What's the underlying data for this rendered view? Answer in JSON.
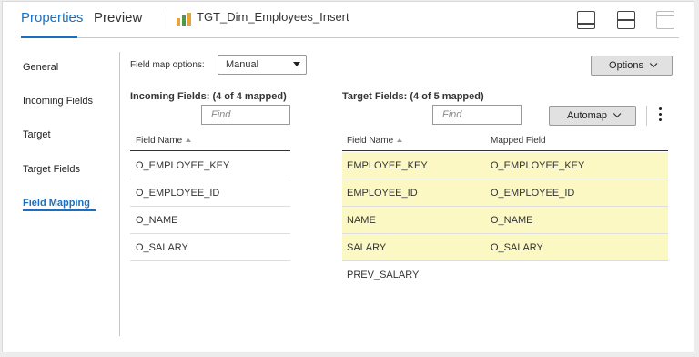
{
  "tabs": [
    {
      "label": "Properties",
      "active": true
    },
    {
      "label": "Preview",
      "active": false
    }
  ],
  "object_title": "TGT_Dim_Employees_Insert",
  "nav_items": [
    "General",
    "Incoming Fields",
    "Target",
    "Target Fields",
    "Field Mapping"
  ],
  "nav_active": "Field Mapping",
  "field_map_options_label": "Field map options:",
  "field_map_options_value": "Manual",
  "options_button": "Options",
  "incoming": {
    "title": "Incoming Fields: (4 of 4 mapped)",
    "find_placeholder": "Find",
    "header": "Field Name",
    "rows": [
      "O_EMPLOYEE_KEY",
      "O_EMPLOYEE_ID",
      "O_NAME",
      "O_SALARY"
    ]
  },
  "target": {
    "title": "Target Fields: (4 of 5 mapped)",
    "find_placeholder": "Find",
    "automap_button": "Automap",
    "header_field": "Field Name",
    "header_mapped": "Mapped Field",
    "rows": [
      {
        "field": "EMPLOYEE_KEY",
        "mapped": "O_EMPLOYEE_KEY"
      },
      {
        "field": "EMPLOYEE_ID",
        "mapped": "O_EMPLOYEE_ID"
      },
      {
        "field": "NAME",
        "mapped": "O_NAME"
      },
      {
        "field": "SALARY",
        "mapped": "O_SALARY"
      },
      {
        "field": "PREV_SALARY",
        "mapped": ""
      }
    ]
  },
  "colors": {
    "accent": "#1a6fc2",
    "mapped_row": "#fbf8c4"
  }
}
